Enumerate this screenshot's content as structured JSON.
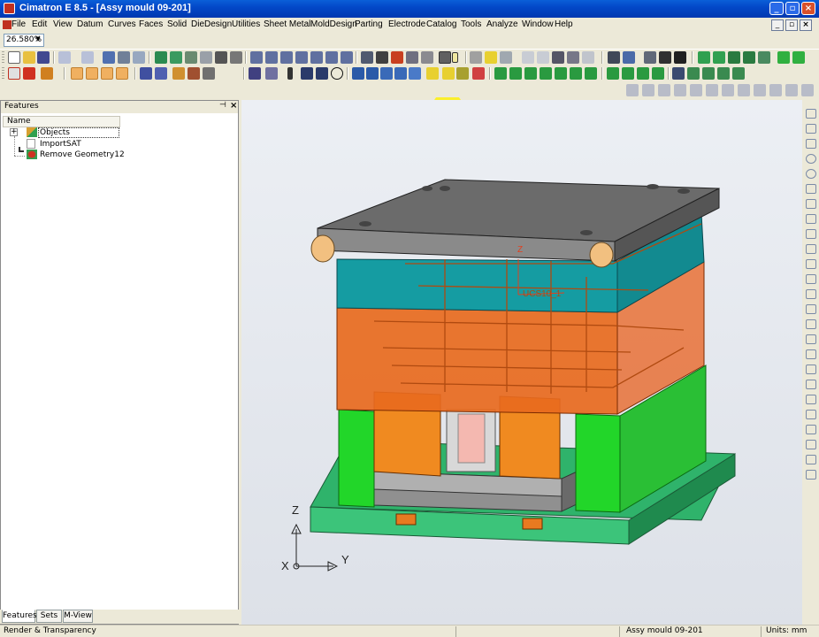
{
  "window": {
    "title": "Cimatron E 8.5 - [Assy mould 09-201]",
    "minimize_glyph": "_",
    "restore_glyph": "▫",
    "close_glyph": "×",
    "mdi_minimize_glyph": "_",
    "mdi_restore_glyph": "▫",
    "mdi_close_glyph": "×"
  },
  "menu": {
    "items": [
      "File",
      "Edit",
      "View",
      "Datum",
      "Curves",
      "Faces",
      "Solid",
      "DieDesign",
      "Utilities",
      "Sheet Metal",
      "MoldDesign",
      "Parting",
      "Electrode",
      "Catalog",
      "Tools",
      "Analyze",
      "Window",
      "Help"
    ]
  },
  "zoom": {
    "value": "26.580%",
    "dropdown_glyph": "▼"
  },
  "features_panel": {
    "title": "Features",
    "pin_glyph": "⊣",
    "close_glyph": "×",
    "column_name": "Name",
    "expand_glyph": "+",
    "items": [
      {
        "label": "Objects",
        "icon": "objects-icon"
      },
      {
        "label": "ImportSAT",
        "icon": "import-icon"
      },
      {
        "label": "Remove Geometry12",
        "icon": "remove-geometry-icon"
      }
    ],
    "tabs": [
      "Features",
      "Sets",
      "M-View"
    ]
  },
  "viewport": {
    "ucs_label": "UCS10_1",
    "ucs_axis_z": "Z",
    "triad": {
      "z": "Z",
      "x": "X",
      "y": "Y"
    }
  },
  "status": {
    "left": "Render & Transparency",
    "document": "Assy mould 09-201",
    "units": "Units: mm"
  },
  "colors": {
    "title_bar": "#0348C8",
    "top_plate": "#6B6B6B",
    "cavity_plate": "#159CA2",
    "core_plate": "#E86A1E",
    "spacer_block": "#22D629",
    "base_plate": "#2CB36B",
    "highlight": "#FFF000"
  }
}
